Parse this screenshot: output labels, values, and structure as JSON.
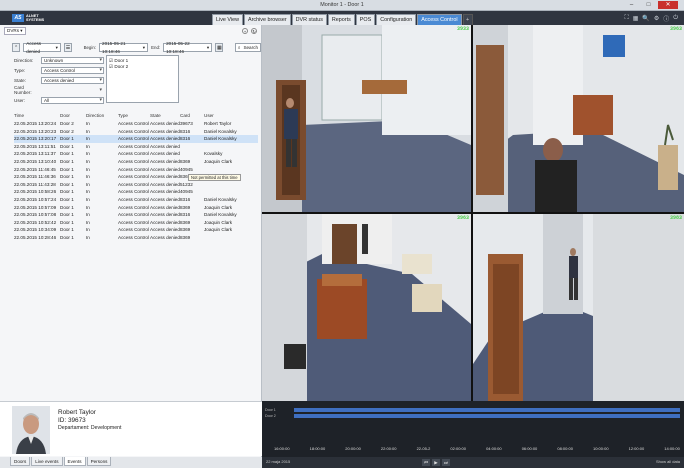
{
  "window": {
    "title": "Monitor 1 - Door 1",
    "minimize_icon": "minimize-icon",
    "maximize_icon": "maximize-icon",
    "close_icon": "close-icon"
  },
  "logo": {
    "mark": "AS",
    "text_line1": "ALNET",
    "text_line2": "SYSTEMS"
  },
  "tabs": [
    {
      "label": "Live View"
    },
    {
      "label": "Archive browser"
    },
    {
      "label": "DVR status"
    },
    {
      "label": "Reports"
    },
    {
      "label": "POS"
    },
    {
      "label": "Configuration"
    },
    {
      "label": "Access Control",
      "active": true
    },
    {
      "label": "+"
    }
  ],
  "left_top": {
    "label": "DVRs"
  },
  "filter": {
    "event_type": "Access denied",
    "begin_label": "Begin:",
    "begin_value": "2015-05-21 10:18:46",
    "end_label": "End:",
    "end_value": "2015-05-22 10:18:46",
    "search_label": "Search"
  },
  "fields": [
    {
      "label": "Direction:",
      "value": "Unknown"
    },
    {
      "label": "Type:",
      "value": "Access Control"
    },
    {
      "label": "State:",
      "value": "Access denied"
    },
    {
      "label": "Card Number:",
      "value": ""
    },
    {
      "label": "User:",
      "value": "All"
    }
  ],
  "doors": [
    "Door 1",
    "Door 2"
  ],
  "table": {
    "columns": [
      "Time",
      "Door",
      "Direction",
      "Type",
      "State",
      "Card",
      "User"
    ],
    "rows": [
      [
        "22.05.2015 13:20:24",
        "Door 2",
        "In",
        "Access Control",
        "Access denied",
        "39673",
        "Robert Taylor"
      ],
      [
        "22.05.2015 13:20:23",
        "Door 2",
        "In",
        "Access Control",
        "Access denied",
        "8316",
        "Daniel Kovalsky"
      ],
      [
        "22.05.2015 13:20:17",
        "Door 1",
        "In",
        "Access Control",
        "Access denied",
        "8316",
        "Daniel Kovalsky"
      ],
      [
        "22.05.2015 13:11:51",
        "Door 1",
        "In",
        "Access Control",
        "Access denied",
        "",
        ""
      ],
      [
        "22.05.2015 13:11:37",
        "Door 1",
        "In",
        "Access Control",
        "Access denied",
        "",
        "Kovalsky"
      ],
      [
        "22.05.2015 13:10:40",
        "Door 1",
        "In",
        "Access Control",
        "Access denied",
        "8369",
        "Joaquin Clark"
      ],
      [
        "22.05.2015 11:46:45",
        "Door 1",
        "In",
        "Access Control",
        "Access denied",
        "40945",
        ""
      ],
      [
        "22.05.2015 11:46:36",
        "Door 1",
        "In",
        "Access Control",
        "Access denied",
        "8369",
        "Joaquin Clark"
      ],
      [
        "22.05.2015 11:43:28",
        "Door 1",
        "In",
        "Access Control",
        "Access denied",
        "51232",
        ""
      ],
      [
        "22.05.2015 10:58:26",
        "Door 1",
        "In",
        "Access Control",
        "Access denied",
        "40945",
        ""
      ],
      [
        "22.05.2015 10:57:24",
        "Door 1",
        "In",
        "Access Control",
        "Access denied",
        "8316",
        "Daniel Kovalsky"
      ],
      [
        "22.05.2015 10:57:09",
        "Door 1",
        "In",
        "Access Control",
        "Access denied",
        "8369",
        "Joaquin Clark"
      ],
      [
        "22.05.2015 10:57:08",
        "Door 1",
        "In",
        "Access Control",
        "Access denied",
        "8316",
        "Daniel Kovalsky"
      ],
      [
        "22.05.2015 10:52:42",
        "Door 1",
        "In",
        "Access Control",
        "Access denied",
        "8369",
        "Joaquin Clark"
      ],
      [
        "22.05.2015 10:34:09",
        "Door 1",
        "In",
        "Access Control",
        "Access denied",
        "8369",
        "Joaquin Clark"
      ],
      [
        "22.05.2015 10:28:46",
        "Door 1",
        "In",
        "Access Control",
        "Access denied",
        "8369",
        ""
      ]
    ],
    "selected_row": 2,
    "tooltip": "Not permitted at this time"
  },
  "person": {
    "name": "Robert Taylor",
    "id": "ID: 39673",
    "department": "Departament: Development"
  },
  "bottom_tabs": [
    "Doors",
    "Live events",
    "Events",
    "Persons"
  ],
  "cameras": [
    {
      "label": "3933"
    },
    {
      "label": "3963"
    },
    {
      "label": "3963"
    },
    {
      "label": "3983"
    }
  ],
  "timeline": {
    "track_labels": [
      "Door 1",
      "Door 2"
    ],
    "ticks": [
      "16:00:00",
      "18:00:00",
      "20:00:00",
      "22:00:00",
      "22-05-2",
      "02:00:00",
      "04:00:00",
      "06:00:00",
      "08:00:00",
      "10:00:00",
      "12:00:00",
      "14:00:00"
    ],
    "date": "22 maja 2015",
    "right_text": "Show all data"
  },
  "colors": {
    "accent": "#4a8ad4",
    "timeline_bar": "#3f6fc0",
    "camera_label": "#4ccf4c"
  }
}
